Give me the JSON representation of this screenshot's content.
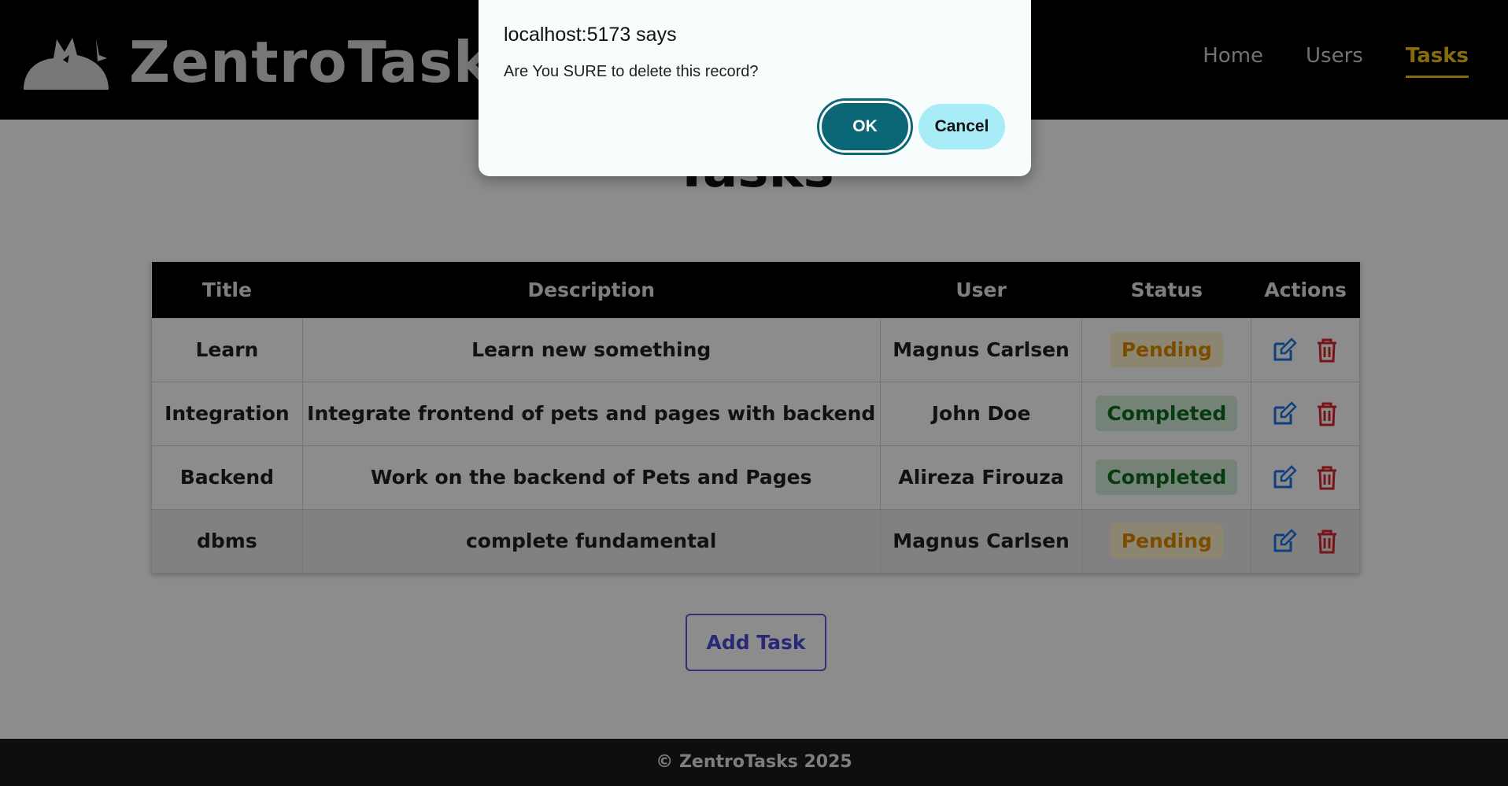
{
  "header": {
    "logo_icon": "cat-logo-icon",
    "brand": "ZentroTasks",
    "nav": [
      {
        "label": "Home",
        "active": false
      },
      {
        "label": "Users",
        "active": false
      },
      {
        "label": "Tasks",
        "active": true
      }
    ]
  },
  "main": {
    "title": "Tasks",
    "table": {
      "columns": [
        "Title",
        "Description",
        "User",
        "Status",
        "Actions"
      ],
      "rows": [
        {
          "title": "Learn",
          "description": "Learn new something",
          "user": "Magnus Carlsen",
          "status": "Pending"
        },
        {
          "title": "Integration",
          "description": "Integrate frontend of pets and pages with backend",
          "user": "John Doe",
          "status": "Completed"
        },
        {
          "title": "Backend",
          "description": "Work on the backend of Pets and Pages",
          "user": "Alireza Firouza",
          "status": "Completed"
        },
        {
          "title": "dbms",
          "description": "complete fundamental",
          "user": "Magnus Carlsen",
          "status": "Pending"
        }
      ],
      "action_icons": [
        "edit-icon",
        "trash-icon"
      ]
    },
    "add_button": "Add Task"
  },
  "footer": {
    "text": "© ZentroTasks 2025"
  },
  "dialog": {
    "title": "localhost:5173 says",
    "message": "Are You SURE to delete this record?",
    "ok": "OK",
    "cancel": "Cancel"
  },
  "colors": {
    "accent": "#f5c518",
    "pending_text": "#e08a00",
    "pending_bg": "#fff3cd",
    "completed_text": "#0d6b1d",
    "completed_bg": "#d4edda",
    "edit": "#1a73e8",
    "delete": "#d9262c",
    "dialog_ok": "#0b6776",
    "dialog_cancel": "#a8ecf8"
  }
}
